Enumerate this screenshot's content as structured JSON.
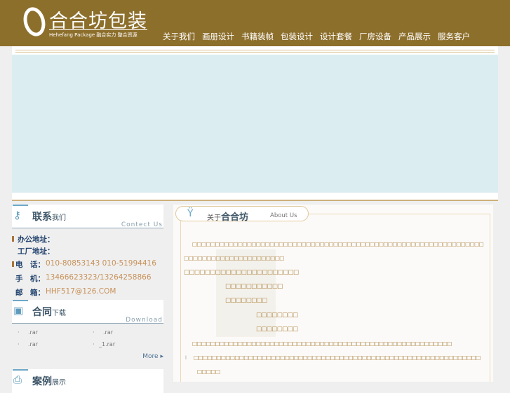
{
  "header": {
    "logo_cn": "合合坊包装",
    "logo_en": "Hehefang Package 融合实力  整合资源",
    "nav": [
      "关于我们",
      "画册设计",
      "书籍装帧",
      "包装设计",
      "设计套餐",
      "厂房设备",
      "产品展示",
      "服务客户"
    ]
  },
  "contact": {
    "title": "联系",
    "title_small": "我们",
    "title_en": "Contect Us",
    "rows": [
      {
        "label": "办公地址：",
        "value": ""
      },
      {
        "label": "工厂地址：",
        "value": ""
      },
      {
        "label": "电　话：",
        "value": "010-80853143 010-51994416"
      },
      {
        "label": "手　机：",
        "value": "13466623323/13264258866"
      },
      {
        "label": "邮　箱：",
        "value": "HHF517@126.COM"
      }
    ]
  },
  "download": {
    "title": "合同",
    "title_small": "下载",
    "title_en": "Download",
    "files": [
      ".rar",
      ".rar",
      ".rar",
      "_1.rar"
    ],
    "more": "More"
  },
  "cases": {
    "title": "案例",
    "title_small": "展示"
  },
  "about": {
    "title_small": "关于",
    "title": "合合坊",
    "title_en": "About Us",
    "paras": [
      "□□□□□□□□□□□□□□□□□□□□□□□□□□□□□□□□□□□□□□□□□□□□□□□□□□□□□□□□□□□□□□□□",
      "□□□□□□□□□□□□□□□□□□□□□□",
      "□□□□□□□□□□□□□□□□□□□□□□",
      "□□□□□□□□□□□",
      "□□□□□□□□",
      "□□□□□□□□",
      "□□□□□□□□",
      "□□□□□□□□□□□□□□□□□□□□□□□□□□□□□□□□□□□□□□□□□□□□□□□□□□□□□□□□□",
      "l",
      "□□□□□□□□□□□□□□□□□□□□□□□□□□□□□□□□□□□□□□□□□□□□□□□□□□□□□□□□□□□□□□□",
      "□□□□□"
    ]
  }
}
